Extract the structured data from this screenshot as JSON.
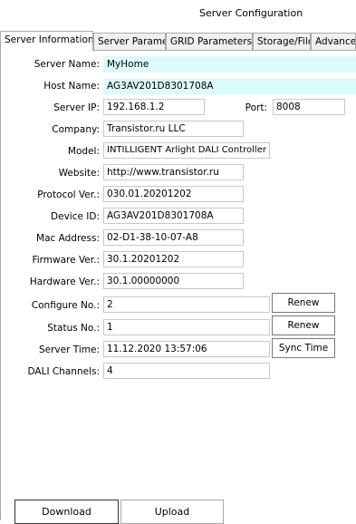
{
  "window": {
    "title": "Server Configuration"
  },
  "tabs": [
    {
      "label": "Server Information",
      "active": true
    },
    {
      "label": "Server Parameters",
      "active": false
    },
    {
      "label": "GRID Parameters",
      "active": false
    },
    {
      "label": "Storage/Files",
      "active": false
    },
    {
      "label": "Advance",
      "active": false
    }
  ],
  "form": {
    "server_name": {
      "label": "Server Name:",
      "value": "MyHome"
    },
    "host_name": {
      "label": "Host Name:",
      "value": "AG3AV201D8301708A"
    },
    "server_ip": {
      "label": "Server IP:",
      "value": "192.168.1.2"
    },
    "port": {
      "label": "Port:",
      "value": "8008"
    },
    "company": {
      "label": "Company:",
      "value": "Transistor.ru LLC"
    },
    "model": {
      "label": "Model:",
      "value": "INTILLIGENT Arlight DALI Controller"
    },
    "website": {
      "label": "Website:",
      "value": "http://www.transistor.ru"
    },
    "protocol_ver": {
      "label": "Protocol Ver.:",
      "value": "030.01.20201202"
    },
    "device_id": {
      "label": "Device ID:",
      "value": "AG3AV201D8301708A"
    },
    "mac_address": {
      "label": "Mac Address:",
      "value": "02-D1-38-10-07-A8"
    },
    "firmware_ver": {
      "label": "Firmware Ver.:",
      "value": "30.1.20201202"
    },
    "hardware_ver": {
      "label": "Hardware Ver.:",
      "value": "30.1.00000000"
    },
    "configure_no": {
      "label": "Configure No.:",
      "value": "2",
      "button": "Renew"
    },
    "status_no": {
      "label": "Status No.:",
      "value": "1",
      "button": "Renew"
    },
    "server_time": {
      "label": "Server Time:",
      "value": "11.12.2020 13:57:06",
      "button": "Sync Time"
    },
    "dali_channels": {
      "label": "DALI Channels:",
      "value": "4"
    }
  },
  "footer": {
    "download_label": "Download",
    "upload_label": "Upload"
  },
  "colors": {
    "highlight_field": "#ddfbfb"
  }
}
